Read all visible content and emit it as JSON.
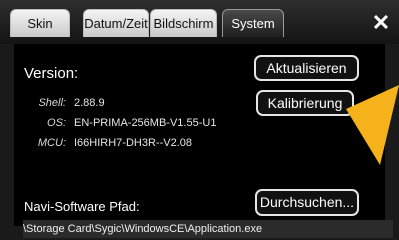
{
  "tabs": [
    {
      "label": "Skin",
      "active": false
    },
    {
      "label": "Datum/Zeit",
      "active": false
    },
    {
      "label": "Bildschirm",
      "active": false
    },
    {
      "label": "System",
      "active": true
    }
  ],
  "close_icon": "close-icon",
  "version": {
    "label": "Version:",
    "update_button": "Aktualisieren",
    "calibrate_button": "Kalibrierung"
  },
  "info": {
    "shell_key": "Shell:",
    "shell_val": "2.88.9",
    "os_key": "OS:",
    "os_val": "EN-PRIMA-256MB-V1.55-U1",
    "mcu_key": "MCU:",
    "mcu_val": "I66HIRH7-DH3R--V2.08"
  },
  "navi": {
    "label": "Navi-Software Pfad:",
    "browse_button": "Durchsuchen...",
    "path": "\\Storage Card\\Sygic\\WindowsCE\\Application.exe"
  },
  "colors": {
    "cursor": "#f5b21b",
    "background": "#000000"
  }
}
